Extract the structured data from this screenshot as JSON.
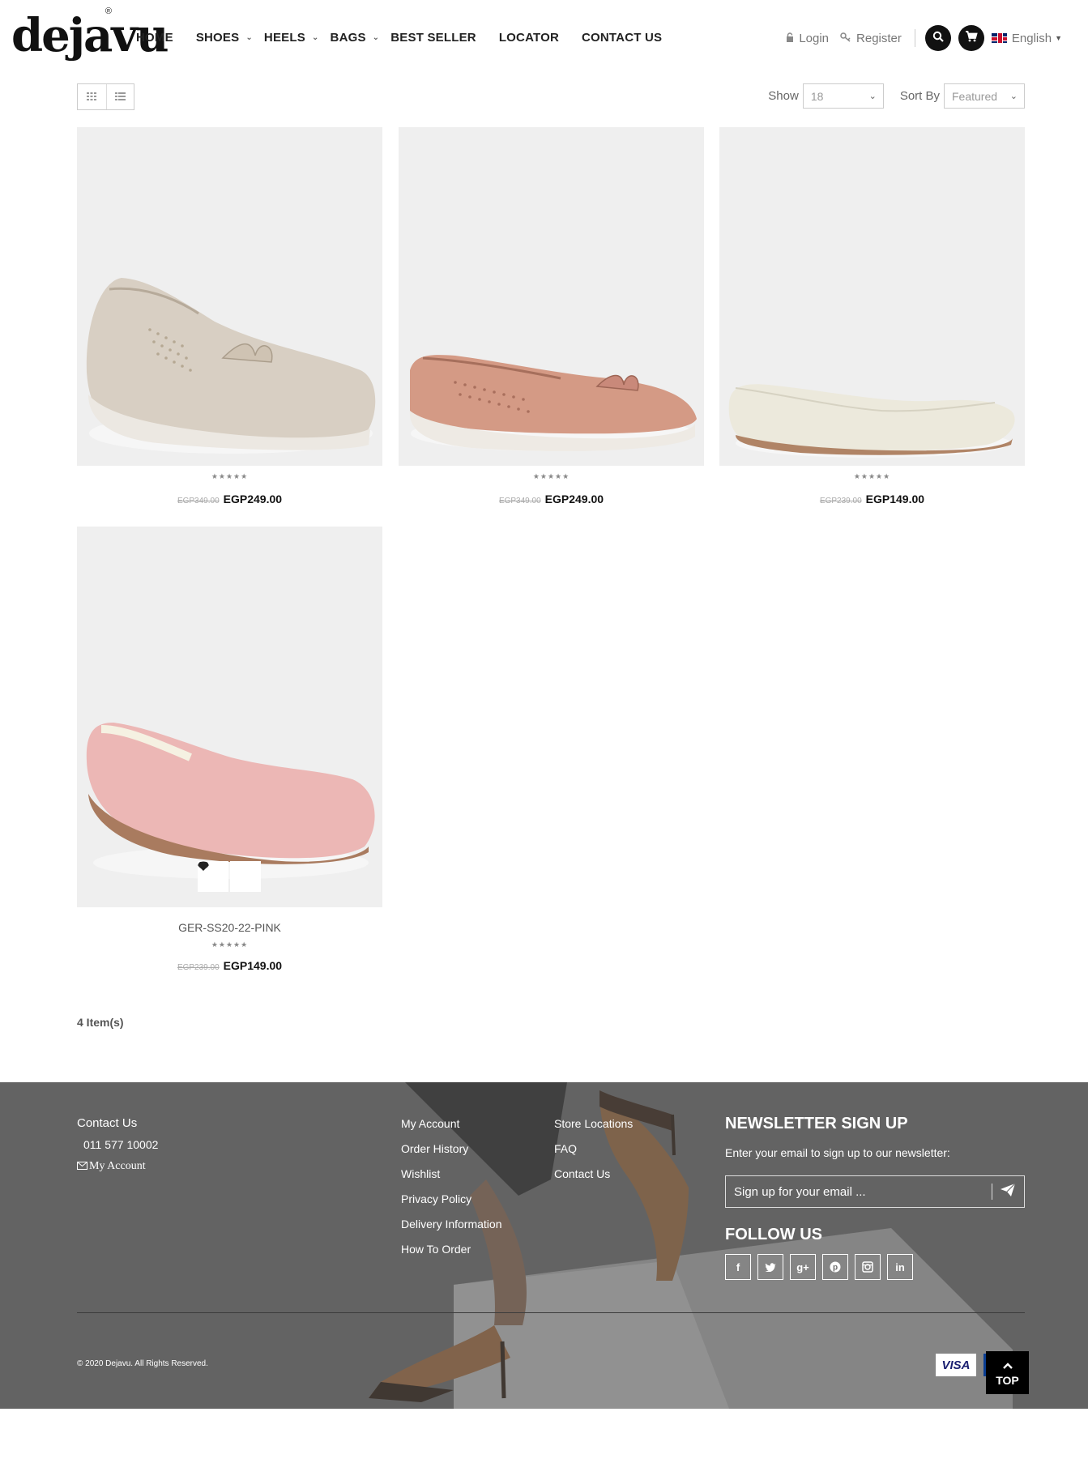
{
  "brand": {
    "logo_text": "dejavu",
    "reg_mark": "®"
  },
  "nav": {
    "items": [
      {
        "label": "HOME",
        "dropdown": false
      },
      {
        "label": "SHOES",
        "dropdown": true
      },
      {
        "label": "HEELS",
        "dropdown": true
      },
      {
        "label": "BAGS",
        "dropdown": true
      },
      {
        "label": "BEST SELLER",
        "dropdown": false
      },
      {
        "label": "LOCATOR",
        "dropdown": false
      },
      {
        "label": "CONTACT US",
        "dropdown": false
      }
    ]
  },
  "account": {
    "login": "Login",
    "register": "Register",
    "language": "English"
  },
  "toolbar": {
    "show_label": "Show",
    "show_value": "18",
    "sort_label": "Sort By",
    "sort_value": "Featured"
  },
  "products": [
    {
      "name": "",
      "rating": 0,
      "old_price": "EGP349.00",
      "price": "EGP249.00",
      "color": "#d8cfc3"
    },
    {
      "name": "",
      "rating": 0,
      "old_price": "EGP349.00",
      "price": "EGP249.00",
      "color": "#d49a85"
    },
    {
      "name": "",
      "rating": 0,
      "old_price": "EGP239.00",
      "price": "EGP149.00",
      "color": "#ece9dc"
    },
    {
      "name": "GER-SS20-22-PINK",
      "rating": 0,
      "old_price": "EGP239.00",
      "price": "EGP149.00",
      "color": "#ecb7b5"
    }
  ],
  "items_count": "4 Item(s)",
  "footer": {
    "contact_title": "Contact Us",
    "phone": "011 577 10002",
    "my_account": "My Account",
    "links_col1": [
      "My Account",
      "Order History",
      "Wishlist",
      "Privacy Policy",
      "Delivery Information",
      "How To Order"
    ],
    "links_col2": [
      "Store Locations",
      "FAQ",
      "Contact Us"
    ],
    "newsletter_title": "NEWSLETTER SIGN UP",
    "newsletter_sub": "Enter your email to sign up to our newsletter:",
    "newsletter_placeholder": "Sign up for your email ...",
    "follow_title": "FOLLOW US",
    "socials": [
      "facebook-icon",
      "twitter-icon",
      "google-plus-icon",
      "pinterest-icon",
      "instagram-icon",
      "linkedin-icon"
    ],
    "copyright": "© 2020 Dejavu. All Rights Reserved.",
    "visa": "VISA",
    "top_label": "TOP"
  }
}
